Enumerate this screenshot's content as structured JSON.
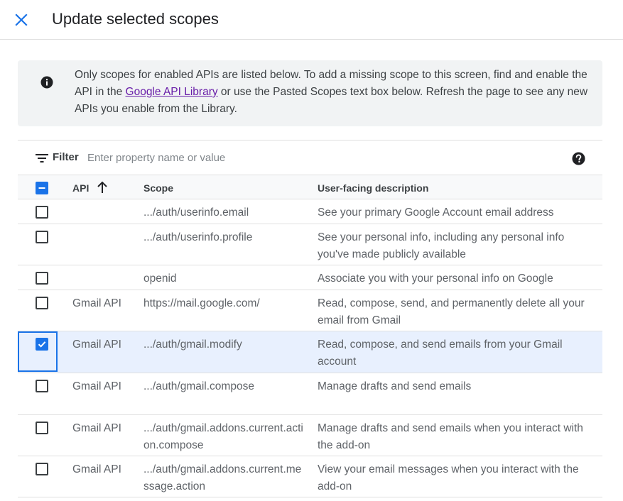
{
  "header": {
    "title": "Update selected scopes",
    "close_icon": "close-icon"
  },
  "info": {
    "icon": "info-icon",
    "text_before": "Only scopes for enabled APIs are listed below. To add a missing scope to this screen, find and enable the API in the ",
    "link_text": "Google API Library",
    "text_after": " or use the Pasted Scopes text box below. Refresh the page to see any new APIs you enable from the Library."
  },
  "filter": {
    "label": "Filter",
    "placeholder": "Enter property name or value",
    "icon": "filter-icon",
    "help_icon": "help-icon"
  },
  "table": {
    "columns": {
      "api": "API",
      "scope": "Scope",
      "description": "User-facing description"
    },
    "sort": "ascending",
    "header_checkbox": "indeterminate",
    "rows": [
      {
        "api": "",
        "scope": ".../auth/userinfo.email",
        "description": "See your primary Google Account email address",
        "checked": false
      },
      {
        "api": "",
        "scope": ".../auth/userinfo.profile",
        "description": "See your personal info, including any personal info you've made publicly available",
        "checked": false
      },
      {
        "api": "",
        "scope": "openid",
        "description": "Associate you with your personal info on Google",
        "checked": false
      },
      {
        "api": "Gmail API",
        "scope": "https://mail.google.com/",
        "description": "Read, compose, send, and permanently delete all your email from Gmail",
        "checked": false
      },
      {
        "api": "Gmail API",
        "scope": ".../auth/gmail.modify",
        "description": "Read, compose, and send emails from your Gmail account",
        "checked": true
      },
      {
        "api": "Gmail API",
        "scope": ".../auth/gmail.compose",
        "description": "Manage drafts and send emails",
        "checked": false
      },
      {
        "api": "Gmail API",
        "scope": ".../auth/gmail.addons.current.action.compose",
        "description": "Manage drafts and send emails when you interact with the add-on",
        "checked": false
      },
      {
        "api": "Gmail API",
        "scope": ".../auth/gmail.addons.current.message.action",
        "description": "View your email messages when you interact with the add-on",
        "checked": false
      }
    ]
  },
  "colors": {
    "accent": "#1a73e8",
    "link": "#681da8",
    "selected_row": "#e8f0fe",
    "info_bg": "#f1f3f4"
  }
}
